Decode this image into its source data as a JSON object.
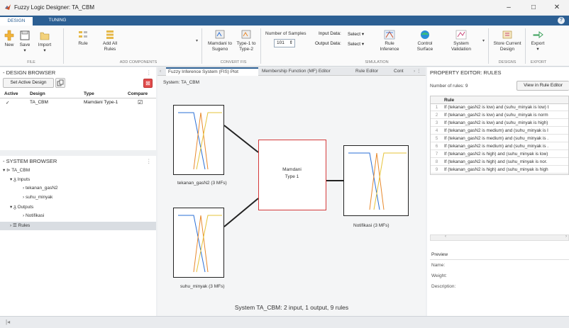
{
  "window": {
    "title": "Fuzzy Logic Designer: TA_CBM",
    "controls": {
      "minimize": "–",
      "maximize": "□",
      "close": "✕"
    }
  },
  "ribbon_tabs": [
    {
      "label": "DESIGN",
      "active": true
    },
    {
      "label": "TUNING",
      "active": false
    }
  ],
  "help_label": "?",
  "toolbar": {
    "new_label": "New",
    "save_label": "Save",
    "import_label": "Import",
    "rule_label": "Rule",
    "add_all_rules_label": "Add All Rules",
    "mamdani_to_sugeno_label": "Mamdani to Sugeno",
    "type1_to_type2_label": "Type-1 to Type-2",
    "num_samples_label": "Number of Samples",
    "num_samples_value": "101",
    "input_data_label": "Input Data:",
    "input_data_value": "Select",
    "output_data_label": "Output Data:",
    "output_data_value": "Select",
    "rule_inference_label": "Rule Inference",
    "control_surface_label": "Control Surface",
    "system_validation_label": "System Validation",
    "store_design_label": "Store Current Design",
    "export_label": "Export"
  },
  "groups": {
    "file": "FILE",
    "add_components": "ADD COMPONENTS",
    "convert_fis": "CONVERT FIS",
    "simulation": "SIMULATION",
    "designs": "DESIGNS",
    "export": "EXPORT"
  },
  "design_browser": {
    "title": "DESIGN BROWSER",
    "set_active_label": "Set Active Design",
    "columns": [
      "Active",
      "Design",
      "Type",
      "Compare"
    ],
    "rows": [
      {
        "active": "✓",
        "design": "TA_CBM",
        "type": "Mamdani Type-1",
        "compare": "☑"
      }
    ]
  },
  "system_browser": {
    "title": "SYSTEM BROWSER",
    "root": "TA_CBM",
    "inputs_label": "Inputs",
    "inputs": [
      "tekanan_gasN2",
      "suhu_minyak"
    ],
    "outputs_label": "Outputs",
    "outputs": [
      "Notifikasi"
    ],
    "rules_label": "Rules"
  },
  "doc_tabs": [
    "Fuzzy Inference System (FIS) Plot",
    "Membership Function (MF) Editor",
    "Rule Editor",
    "Cont"
  ],
  "fis_plot": {
    "system_label": "System: TA_CBM",
    "input1_caption": "tekanan_gasN2 (3 MFs)",
    "input2_caption": "suhu_minyak (3 MFs)",
    "engine_label_line1": "Mamdani",
    "engine_label_line2": "Type 1",
    "output_caption": "Notifikasi (3 MFs)",
    "summary": "System TA_CBM: 2 input, 1 output, 9 rules",
    "colors": {
      "mf1": "#2a6fd6",
      "mf2": "#e8892b",
      "mf3": "#e6c33a",
      "engine_border": "#d43a3a"
    }
  },
  "property_editor": {
    "title": "PROPERTY EDITOR: RULES",
    "num_rules_label": "Number of rules:",
    "num_rules_value": "9",
    "view_button_label": "View in Rule Editor",
    "column_header": "Rule",
    "rules": [
      {
        "n": "1",
        "text": "If (tekanan_gasN2 is low) and (suhu_minyak is low) t"
      },
      {
        "n": "2",
        "text": "If (tekanan_gasN2 is low) and (suhu_minyak is norm"
      },
      {
        "n": "3",
        "text": "If (tekanan_gasN2 is low) and (suhu_minyak is high)"
      },
      {
        "n": "4",
        "text": "If (tekanan_gasN2 is medium) and (suhu_minyak is l"
      },
      {
        "n": "5",
        "text": "If (tekanan_gasN2 is medium) and (suhu_minyak is ."
      },
      {
        "n": "6",
        "text": "If (tekanan_gasN2 is medium) and (suhu_minyak is ."
      },
      {
        "n": "7",
        "text": "If (tekanan_gasN2 is high) and (suhu_minyak is low)"
      },
      {
        "n": "8",
        "text": "If (tekanan_gasN2 is high) and (suhu_minyak is nor."
      },
      {
        "n": "9",
        "text": "If (tekanan_gasN2 is high) and (suhu_minyak is high"
      }
    ],
    "preview_label": "Preview",
    "name_label": "Name:",
    "weight_label": "Weight:",
    "description_label": "Description:"
  },
  "status_bar": {
    "icon": "|◂"
  }
}
